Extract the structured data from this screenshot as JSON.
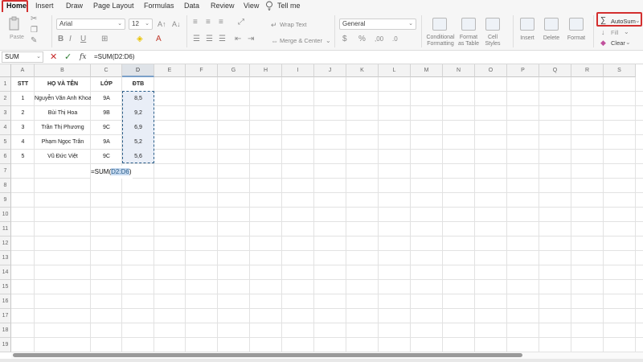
{
  "menu": {
    "items": [
      "Home",
      "Insert",
      "Draw",
      "Page Layout",
      "Formulas",
      "Data",
      "Review",
      "View"
    ],
    "tell_me": "Tell me"
  },
  "ribbon": {
    "paste_label": "Paste",
    "font_name": "Arial",
    "font_size": "12",
    "bold": "B",
    "italic": "I",
    "underline": "U",
    "wrap_text": "Wrap Text",
    "merge_center": "Merge & Center",
    "number_format": "General",
    "conditional_formatting": "Conditional\nFormatting",
    "format_as_table": "Format\nas Table",
    "cell_styles": "Cell\nStyles",
    "insert": "Insert",
    "delete": "Delete",
    "format": "Format",
    "autosum": "AutoSum",
    "fill": "Fill",
    "clear": "Clear",
    "sigma": "∑",
    "dollar": "$",
    "percent": "%"
  },
  "formula_bar": {
    "name_box": "SUM",
    "cancel": "✕",
    "enter": "✓",
    "fx": "fx",
    "formula": "=SUM(D2:D6)"
  },
  "columns": [
    "A",
    "B",
    "C",
    "D",
    "E",
    "F",
    "G",
    "H",
    "I",
    "J",
    "K",
    "L",
    "M",
    "N",
    "O",
    "P",
    "Q",
    "R",
    "S"
  ],
  "rows": [
    "1",
    "2",
    "3",
    "4",
    "5",
    "6",
    "7",
    "8",
    "9",
    "10",
    "11",
    "12",
    "13",
    "14",
    "15",
    "16",
    "17",
    "18",
    "19"
  ],
  "table": {
    "headers": [
      "STT",
      "HỌ VÀ TÊN",
      "LỚP",
      "ĐTB"
    ],
    "rows": [
      [
        "1",
        "Nguyễn Văn Anh Khoa",
        "9A",
        "8,5"
      ],
      [
        "2",
        "Bùi Thị Hoa",
        "9B",
        "9,2"
      ],
      [
        "3",
        "Trần Thị Phương",
        "9C",
        "6,9"
      ],
      [
        "4",
        "Phạm Ngọc Trân",
        "9A",
        "5,2"
      ],
      [
        "5",
        "Vũ Đức Việt",
        "9C",
        "5,6"
      ]
    ]
  },
  "formula_cell": {
    "prefix": "=SUM(",
    "ref": "D2:D6",
    "suffix": ")"
  },
  "colors": {
    "accent_green": "#2e8b57",
    "highlight_red": "#d32f2f",
    "range_blue": "#2c5f8a"
  }
}
